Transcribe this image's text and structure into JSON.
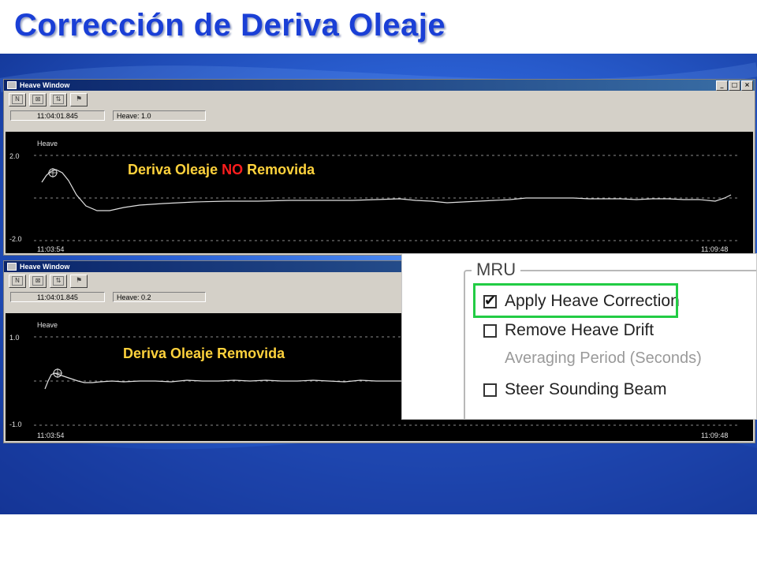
{
  "slide": {
    "title": "Corrección de Deriva Oleaje"
  },
  "windows": [
    {
      "title": "Heave Window",
      "toolbar_buttons": [
        {
          "icon": "n-icon",
          "glyph": "N"
        },
        {
          "icon": "x-box-icon",
          "glyph": "⊠"
        },
        {
          "icon": "up-down-arrows-icon",
          "glyph": "⇅"
        },
        {
          "icon": "flag-icon",
          "glyph": "⚑"
        }
      ],
      "time_field": "11:04:01.845",
      "heave_field": "Heave: 1.0",
      "plot": {
        "series_label": "Heave",
        "y_top": "2.0",
        "y_bottom": "-2.0",
        "x_start": "11:03:54",
        "x_end": "11:09:48"
      },
      "annotation": {
        "part1": "Deriva Oleaje ",
        "part2": "NO",
        "part3": " Removida"
      }
    },
    {
      "title": "Heave Window",
      "toolbar_buttons": [
        {
          "icon": "n-icon",
          "glyph": "N"
        },
        {
          "icon": "x-box-icon",
          "glyph": "⊠"
        },
        {
          "icon": "up-down-arrows-icon",
          "glyph": "⇅"
        },
        {
          "icon": "flag-icon",
          "glyph": "⚑"
        }
      ],
      "time_field": "11:04:01.845",
      "heave_field": "Heave: 0.2",
      "plot": {
        "series_label": "Heave",
        "y_top": "1.0",
        "y_bottom": "-1.0",
        "x_start": "11:03:54",
        "x_end": "11:09:48"
      },
      "annotation": {
        "text": "Deriva Oleaje Removida"
      }
    }
  ],
  "window_controls": {
    "minimize": "_",
    "maximize": "□",
    "close": "×"
  },
  "mru_panel": {
    "legend": "MRU",
    "options": [
      {
        "label": "Apply Heave Correction",
        "checked": true,
        "enabled": true,
        "highlighted": true
      },
      {
        "label": "Remove Heave Drift",
        "checked": false,
        "enabled": true
      },
      {
        "label": "Averaging Period (Seconds)",
        "enabled": false
      },
      {
        "label": "Steer Sounding Beam",
        "checked": false,
        "enabled": true
      }
    ],
    "check_glyph": "✔",
    "highlight_color": "#22cc44"
  },
  "colors": {
    "title": "#1a3fd6",
    "annotation": "#ffd23c",
    "annotation_emphasis": "#ff1e1e",
    "plot_bg": "#000000",
    "trace": "#e0e0e0"
  }
}
